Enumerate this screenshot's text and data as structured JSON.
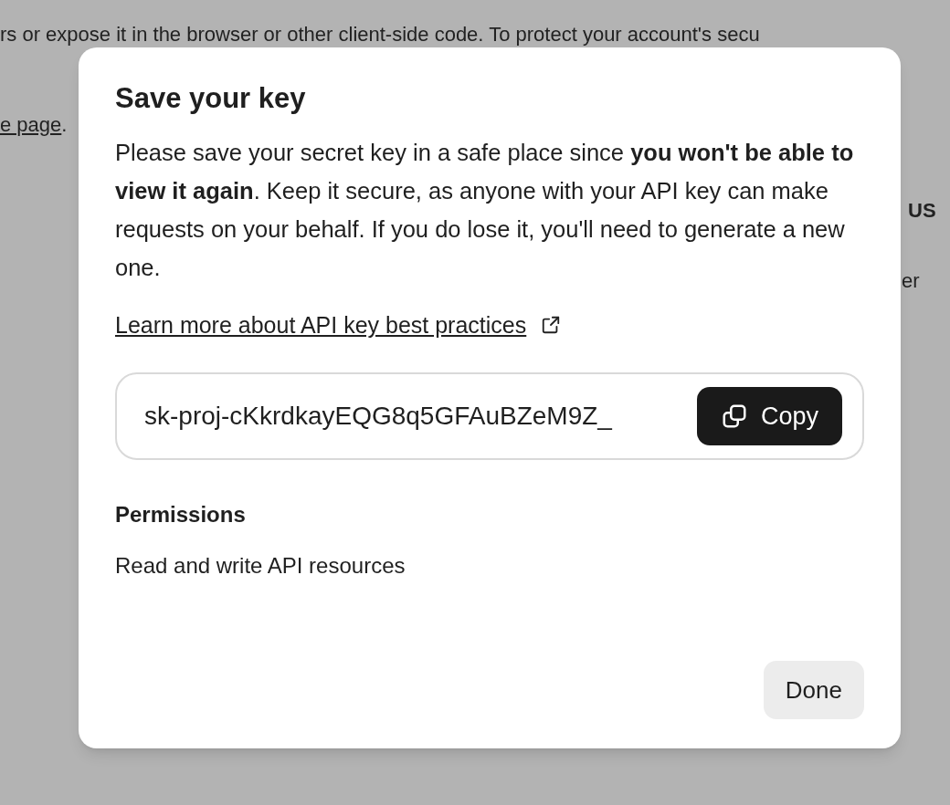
{
  "background_page": {
    "lines": [
      {
        "text": "rs or expose it in the browser or other client-side code. To protect your account's secu",
        "kind": "plain"
      },
      {
        "text": "e page",
        "kind": "link",
        "suffix": "."
      },
      {
        "text": "US",
        "kind": "heading_fragment"
      },
      {
        "text": "er",
        "kind": "plain_fragment"
      }
    ]
  },
  "dialog": {
    "title": "Save your key",
    "message": "Please save your secret key in a safe place since **you won't be able to view it again**. Keep it secure, as anyone with your API key can make requests on your behalf. If you do lose it, you'll need to generate a new one.",
    "link": "Learn more about API key best practices",
    "key_field": {
      "value": "sk-proj-cKkrdkayEQG8q5GFAuBZeM9Z_",
      "copy_button": "Copy"
    },
    "permissions": {
      "label": "Permissions",
      "value": "Read and write API resources"
    },
    "buttons": [
      "Done"
    ]
  }
}
